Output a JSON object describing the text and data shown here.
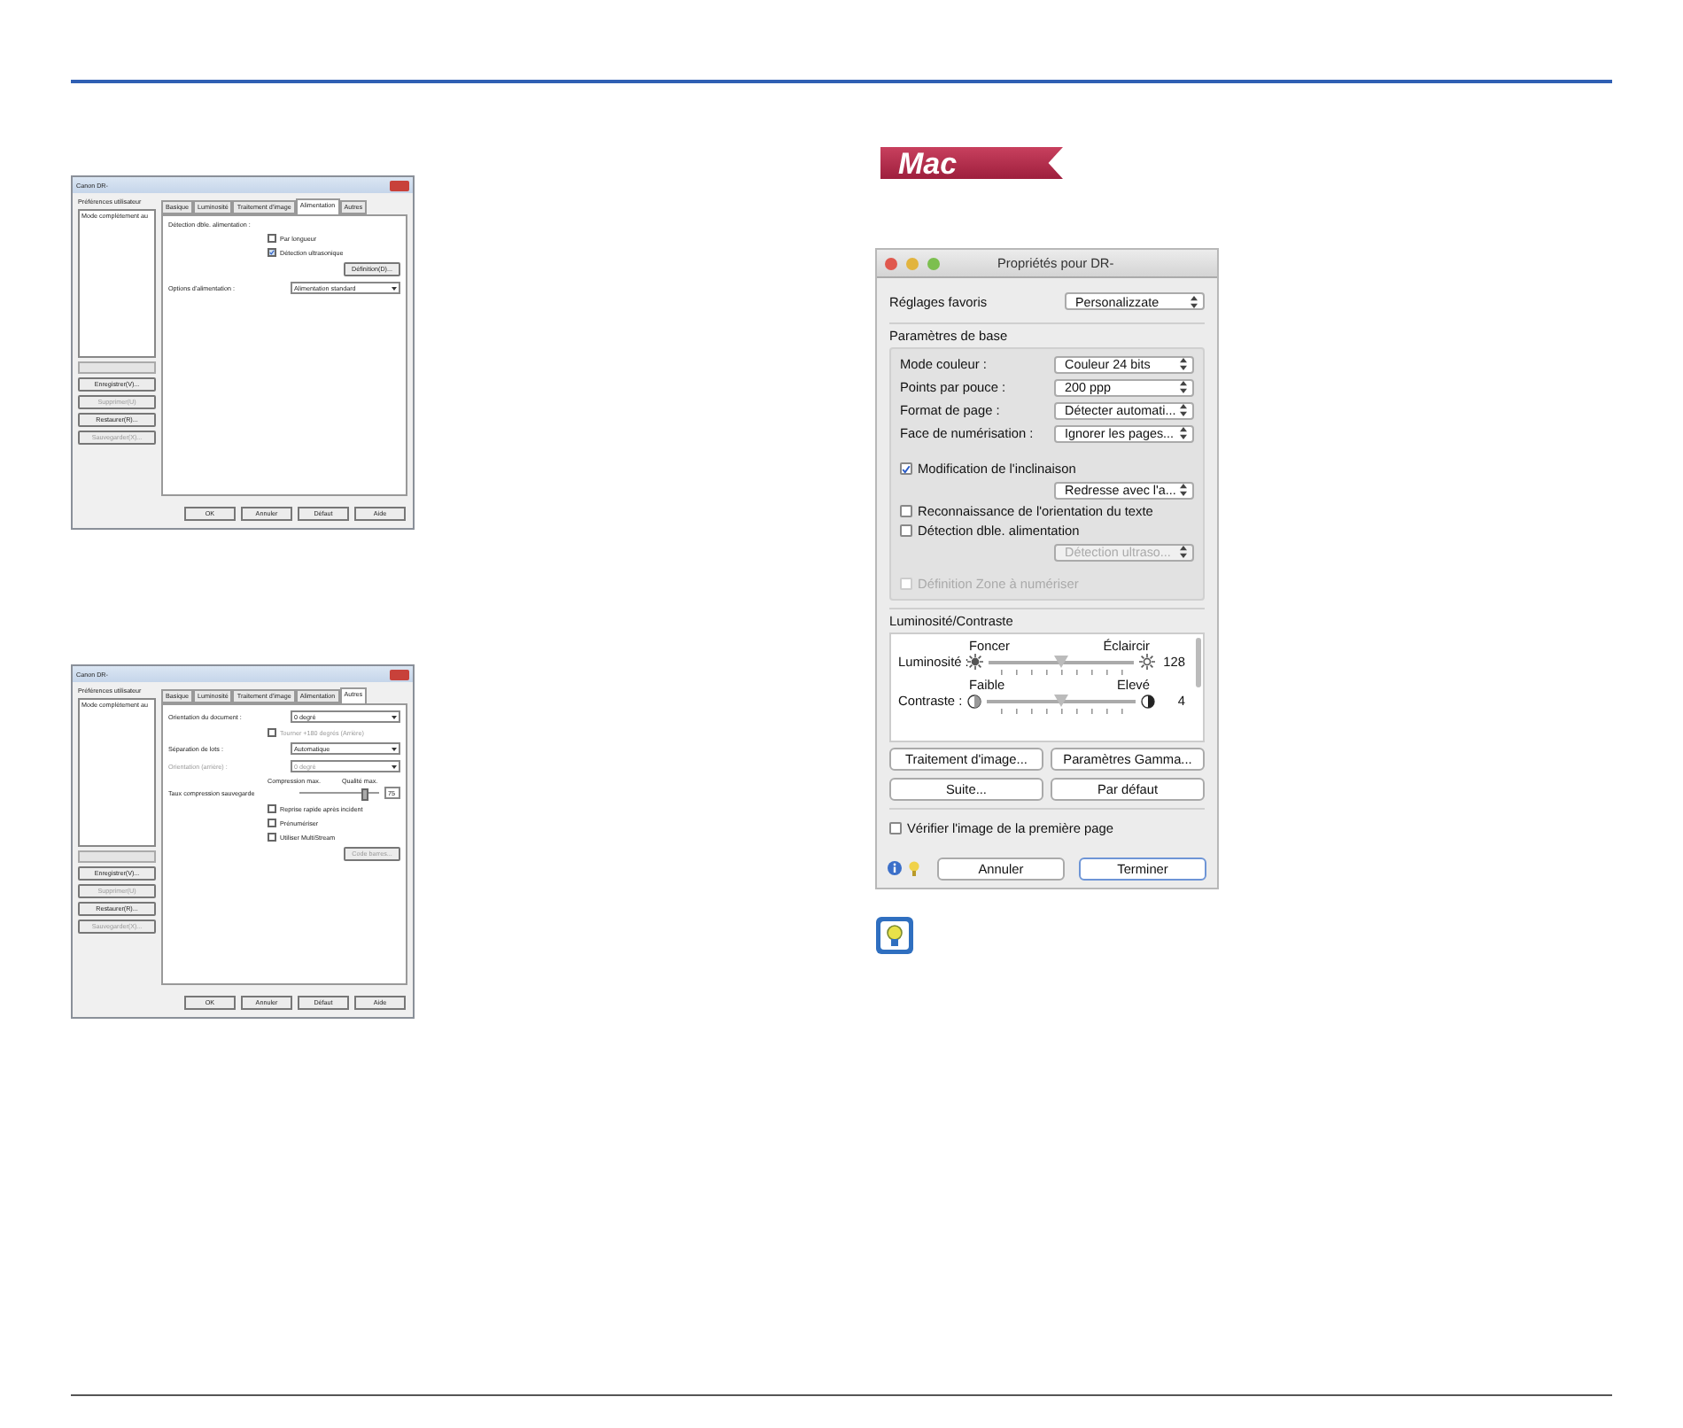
{
  "mac_badge": "Mac",
  "windows_dialogs": [
    {
      "title": "Canon DR-",
      "sidebar_label": "Préférences utilisateur",
      "list_item": "Mode complètement au",
      "side_buttons": [
        {
          "label": "Enregistrer(V)...",
          "disabled": false
        },
        {
          "label": "Supprimer(U)",
          "disabled": true
        },
        {
          "label": "Restaurer(R)...",
          "disabled": false
        },
        {
          "label": "Sauvegarder(X)...",
          "disabled": true
        }
      ],
      "tabs": [
        {
          "label": "Basique",
          "selected": false
        },
        {
          "label": "Luminosité",
          "selected": false
        },
        {
          "label": "Traitement d'image",
          "selected": false
        },
        {
          "label": "Alimentation",
          "selected": true
        },
        {
          "label": "Autres",
          "selected": false
        }
      ],
      "rows": [
        {
          "kind": "label",
          "label": "Détection dble. alimentation :"
        },
        {
          "kind": "checkbox",
          "label": "Par longueur",
          "checked": false,
          "disabled": false
        },
        {
          "kind": "checkbox",
          "label": "Détection ultrasonique",
          "checked": true,
          "disabled": false
        },
        {
          "kind": "button",
          "label": "Définition(D)...",
          "disabled": false
        },
        {
          "kind": "select",
          "label": "Options d'alimentation :",
          "value": "Alimentation standard",
          "disabled": false
        }
      ],
      "buttons": [
        "OK",
        "Annuler",
        "Défaut",
        "Aide"
      ]
    },
    {
      "title": "Canon DR-",
      "sidebar_label": "Préférences utilisateur",
      "list_item": "Mode complètement au",
      "side_buttons": [
        {
          "label": "Enregistrer(V)...",
          "disabled": false
        },
        {
          "label": "Supprimer(U)",
          "disabled": true
        },
        {
          "label": "Restaurer(R)...",
          "disabled": false
        },
        {
          "label": "Sauvegarder(X)...",
          "disabled": true
        }
      ],
      "tabs": [
        {
          "label": "Basique",
          "selected": false
        },
        {
          "label": "Luminosité",
          "selected": false
        },
        {
          "label": "Traitement d'image",
          "selected": false
        },
        {
          "label": "Alimentation",
          "selected": false
        },
        {
          "label": "Autres",
          "selected": true
        }
      ],
      "rows": [
        {
          "kind": "select",
          "label": "Orientation du document :",
          "value": "0 degré",
          "disabled": false
        },
        {
          "kind": "checkbox",
          "label": "Tourner +180 degrés (Arrière)",
          "checked": false,
          "disabled": true
        },
        {
          "kind": "select",
          "label": "Séparation de lots :",
          "value": "Automatique",
          "disabled": false
        },
        {
          "kind": "select",
          "label": "Orientation (arrière) :",
          "value": "0 degré",
          "disabled": true
        },
        {
          "kind": "slider",
          "label": "Taux compression sauvegarde",
          "min_label": "Compression max.",
          "max_label": "Qualité max.",
          "level": 0.78,
          "value": "75"
        },
        {
          "kind": "checkbox",
          "label": "Reprise rapide après incident",
          "checked": false,
          "disabled": false
        },
        {
          "kind": "checkbox",
          "label": "Prénumériser",
          "checked": false,
          "disabled": false
        },
        {
          "kind": "checkbox",
          "label": "Utiliser MultiStream",
          "checked": false,
          "disabled": false
        },
        {
          "kind": "button",
          "label": "Code barres...",
          "disabled": true
        }
      ],
      "buttons": [
        "OK",
        "Annuler",
        "Défaut",
        "Aide"
      ]
    }
  ],
  "mac_dialog": {
    "title": "Propriétés pour DR-",
    "favorites": {
      "label": "Réglages favoris",
      "value": "Personalizzate"
    },
    "basic": {
      "heading": "Paramètres de base",
      "items": [
        {
          "kind": "select",
          "label": "Mode couleur :",
          "value": "Couleur 24 bits"
        },
        {
          "kind": "select",
          "label": "Points par pouce :",
          "value": "200 ppp"
        },
        {
          "kind": "select",
          "label": "Format de page :",
          "value": "Détecter automati..."
        },
        {
          "kind": "select",
          "label": "Face de numérisation :",
          "value": "Ignorer les pages..."
        },
        {
          "kind": "checkbox",
          "label": "Modification de l'inclinaison",
          "checked": true,
          "disabled": false
        },
        {
          "kind": "popup",
          "value": "Redresse avec l'a...",
          "disabled": false
        },
        {
          "kind": "checkbox",
          "label": "Reconnaissance de l'orientation du texte",
          "checked": false,
          "disabled": false
        },
        {
          "kind": "checkbox",
          "label": "Détection dble. alimentation",
          "checked": false,
          "disabled": false
        },
        {
          "kind": "popup",
          "value": "Détection ultraso...",
          "disabled": true
        },
        {
          "kind": "checkbox",
          "label": "Définition Zone à numériser",
          "checked": false,
          "disabled": true
        }
      ]
    },
    "brightness": {
      "heading": "Luminosité/Contraste",
      "sliders": [
        {
          "kind": "sun",
          "label": "Luminosité :",
          "min_label": "Foncer",
          "max_label": "Éclaircir",
          "level": 0.5,
          "value": "128"
        },
        {
          "kind": "contrast",
          "label": "Contraste :",
          "min_label": "Faible",
          "max_label": "Elevé",
          "level": 0.5,
          "value": "4"
        }
      ]
    },
    "buttons": [
      "Traitement d'image...",
      "Paramètres Gamma...",
      "Suite...",
      "Par défaut"
    ],
    "verify": {
      "label": "Vérifier l'image de la première page",
      "checked": false
    },
    "footer_buttons": [
      {
        "label": "Annuler",
        "default": false
      },
      {
        "label": "Terminer",
        "default": true
      }
    ]
  }
}
